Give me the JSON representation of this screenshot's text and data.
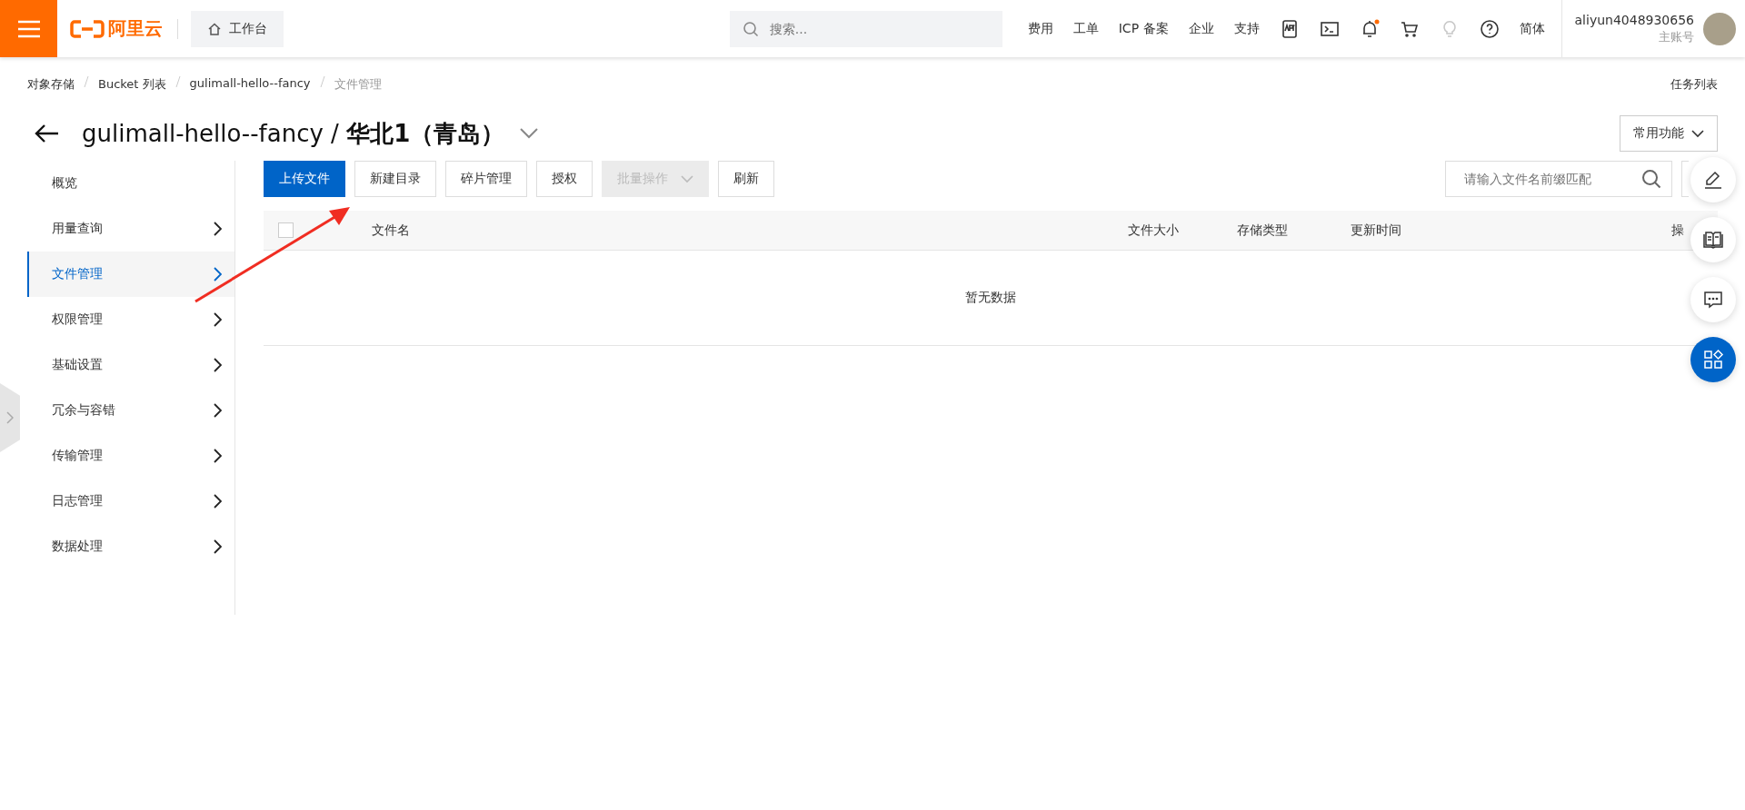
{
  "topbar": {
    "brand": "阿里云",
    "workbench": "工作台",
    "search": {
      "placeholder": "搜索..."
    },
    "links": [
      {
        "kind": "text",
        "label": "费用"
      },
      {
        "kind": "text",
        "label": "工单"
      },
      {
        "kind": "text",
        "label": "ICP 备案"
      },
      {
        "kind": "text",
        "label": "企业"
      },
      {
        "kind": "text",
        "label": "支持"
      },
      {
        "kind": "app"
      },
      {
        "kind": "terminal"
      },
      {
        "kind": "bell",
        "badge": true
      },
      {
        "kind": "cart"
      },
      {
        "kind": "bulb",
        "disabled": true
      },
      {
        "kind": "help"
      },
      {
        "kind": "text",
        "label": "简体"
      }
    ],
    "account": {
      "name": "aliyun4048930656",
      "role": "主账号"
    }
  },
  "breadcrumb": [
    {
      "label": "对象存储",
      "current": false
    },
    {
      "label": "Bucket 列表",
      "current": false
    },
    {
      "label": "gulimall-hello--fancy",
      "current": false
    },
    {
      "label": "文件管理",
      "current": true
    }
  ],
  "task_list": "任务列表",
  "title": {
    "bucket": "gulimall-hello--fancy / ",
    "region": "华北1（青岛）"
  },
  "common_functions": "常用功能",
  "sidebar": {
    "items": [
      {
        "label": "概览",
        "selected": false,
        "has_arrow": false
      },
      {
        "label": "用量查询",
        "selected": false,
        "has_arrow": true
      },
      {
        "label": "文件管理",
        "selected": true,
        "has_arrow": true
      },
      {
        "label": "权限管理",
        "selected": false,
        "has_arrow": true
      },
      {
        "label": "基础设置",
        "selected": false,
        "has_arrow": true
      },
      {
        "label": "冗余与容错",
        "selected": false,
        "has_arrow": true
      },
      {
        "label": "传输管理",
        "selected": false,
        "has_arrow": true
      },
      {
        "label": "日志管理",
        "selected": false,
        "has_arrow": true
      },
      {
        "label": "数据处理",
        "selected": false,
        "has_arrow": true
      }
    ]
  },
  "toolbar": {
    "buttons": [
      {
        "label": "上传文件",
        "primary": true,
        "disabled": false,
        "dropdown": false
      },
      {
        "label": "新建目录",
        "primary": false,
        "disabled": false,
        "dropdown": false
      },
      {
        "label": "碎片管理",
        "primary": false,
        "disabled": false,
        "dropdown": false
      },
      {
        "label": "授权",
        "primary": false,
        "disabled": false,
        "dropdown": false
      },
      {
        "label": "批量操作",
        "primary": false,
        "disabled": true,
        "dropdown": true
      },
      {
        "label": "刷新",
        "primary": false,
        "disabled": false,
        "dropdown": false
      }
    ],
    "search": {
      "placeholder": "请输入文件名前缀匹配"
    }
  },
  "table": {
    "select_all": {
      "checked": false
    },
    "columns": [
      "文件名",
      "文件大小",
      "存储类型",
      "更新时间",
      "操"
    ],
    "empty_text": "暂无数据"
  },
  "float_buttons": [
    {
      "kind": "edit",
      "primary": false
    },
    {
      "kind": "book",
      "primary": false
    },
    {
      "kind": "chat",
      "primary": false
    },
    {
      "kind": "apps",
      "primary": true
    }
  ]
}
